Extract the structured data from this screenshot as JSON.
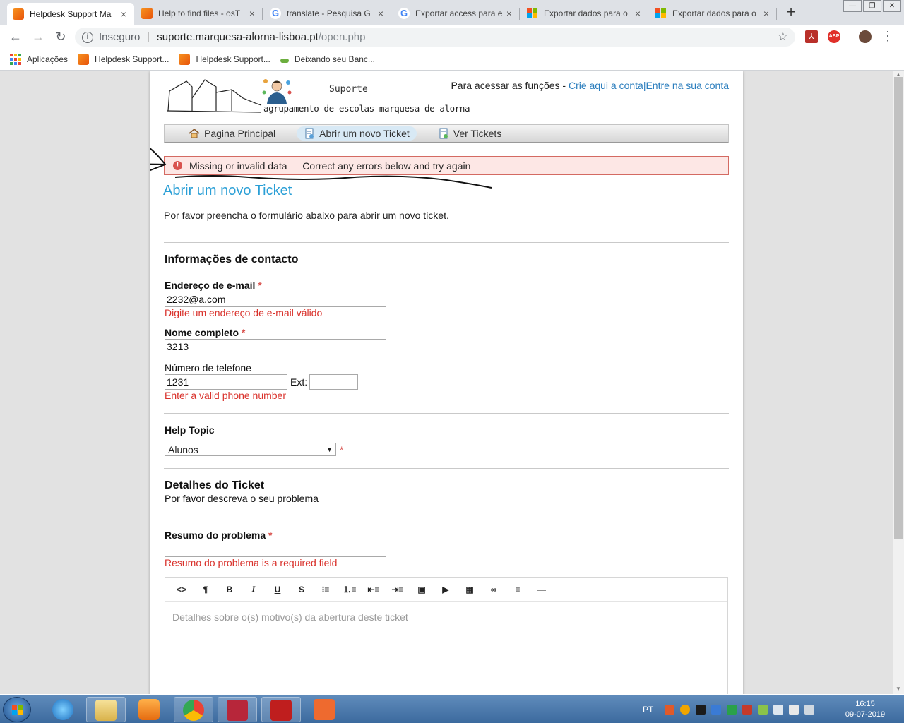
{
  "browser": {
    "tabs": [
      {
        "title": "Helpdesk Support Ma",
        "icon": "osticket-icon",
        "active": true
      },
      {
        "title": "Help to find files - osT",
        "icon": "osticket-icon",
        "active": false
      },
      {
        "title": "translate - Pesquisa G",
        "icon": "google-icon",
        "active": false
      },
      {
        "title": "Exportar access para e",
        "icon": "google-icon",
        "active": false
      },
      {
        "title": "Exportar dados para o",
        "icon": "microsoft-icon",
        "active": false
      },
      {
        "title": "Exportar dados para o",
        "icon": "microsoft-icon",
        "active": false
      }
    ],
    "new_tab": "+",
    "address": {
      "security": "Inseguro",
      "host": "suporte.marquesa-alorna-lisboa.pt",
      "path": "/open.php"
    },
    "bookmarks": [
      {
        "label": "Aplicações",
        "icon": "apps-grid-icon"
      },
      {
        "label": "Helpdesk Support...",
        "icon": "osticket-icon"
      },
      {
        "label": "Helpdesk Support...",
        "icon": "osticket-icon"
      },
      {
        "label": "Deixando seu Banc...",
        "icon": "bank-icon"
      }
    ],
    "extensions": {
      "abp": "ABP"
    }
  },
  "site": {
    "brand_top": "Suporte",
    "brand_bottom": "agrupamento de escolas marquesa de alorna",
    "account_prefix": "Para acessar as funções - ",
    "create_account": "Crie aqui a conta",
    "separator": "|",
    "login": "Entre na sua conta",
    "nav": [
      {
        "label": "Pagina Principal",
        "icon": "home-icon",
        "active": false
      },
      {
        "label": "Abrir um novo Ticket",
        "icon": "new-ticket-icon",
        "active": true
      },
      {
        "label": "Ver Tickets",
        "icon": "view-tickets-icon",
        "active": false
      }
    ]
  },
  "error_banner": "Missing or invalid data — Correct any errors below and try again",
  "form": {
    "title": "Abrir um novo Ticket",
    "intro": "Por favor preencha o formulário abaixo para abrir um novo ticket.",
    "contact_section": "Informações de contacto",
    "email_label": "Endereço de e-mail",
    "email_value": "2232@a.com",
    "email_error": "Digite um endereço de e-mail válido",
    "name_label": "Nome completo",
    "name_value": "3213",
    "phone_label": "Número de telefone",
    "phone_value": "1231",
    "ext_label": "Ext:",
    "ext_value": "",
    "phone_error": "Enter a valid phone number",
    "required_mark": "*",
    "topic_label": "Help Topic",
    "topic_value": "Alunos",
    "details_section": "Detalhes do Ticket",
    "details_sub": "Por favor descreva o seu problema",
    "summary_label": "Resumo do problema",
    "summary_value": "",
    "summary_error": "Resumo do problema is a required field",
    "editor_toolbar": [
      "<>",
      "¶",
      "B",
      "I",
      "U",
      "S",
      "ul",
      "ol",
      "outdent",
      "indent",
      "image",
      "video",
      "table",
      "link",
      "align",
      "hr"
    ],
    "editor_placeholder": "Detalhes sobre o(s) motivo(s) da abertura deste ticket"
  },
  "taskbar": {
    "language": "PT",
    "time": "16:15",
    "date": "09-07-2019",
    "apps": [
      "internet-explorer-icon",
      "file-explorer-icon",
      "media-player-icon",
      "chrome-icon",
      "access-icon",
      "filezilla-icon",
      "presentation-icon"
    ]
  },
  "colors": {
    "link": "#2a7dbd",
    "title": "#2a9fd6",
    "error_text": "#d9312b",
    "error_bg": "#fde7e5",
    "error_border": "#d46a62"
  }
}
